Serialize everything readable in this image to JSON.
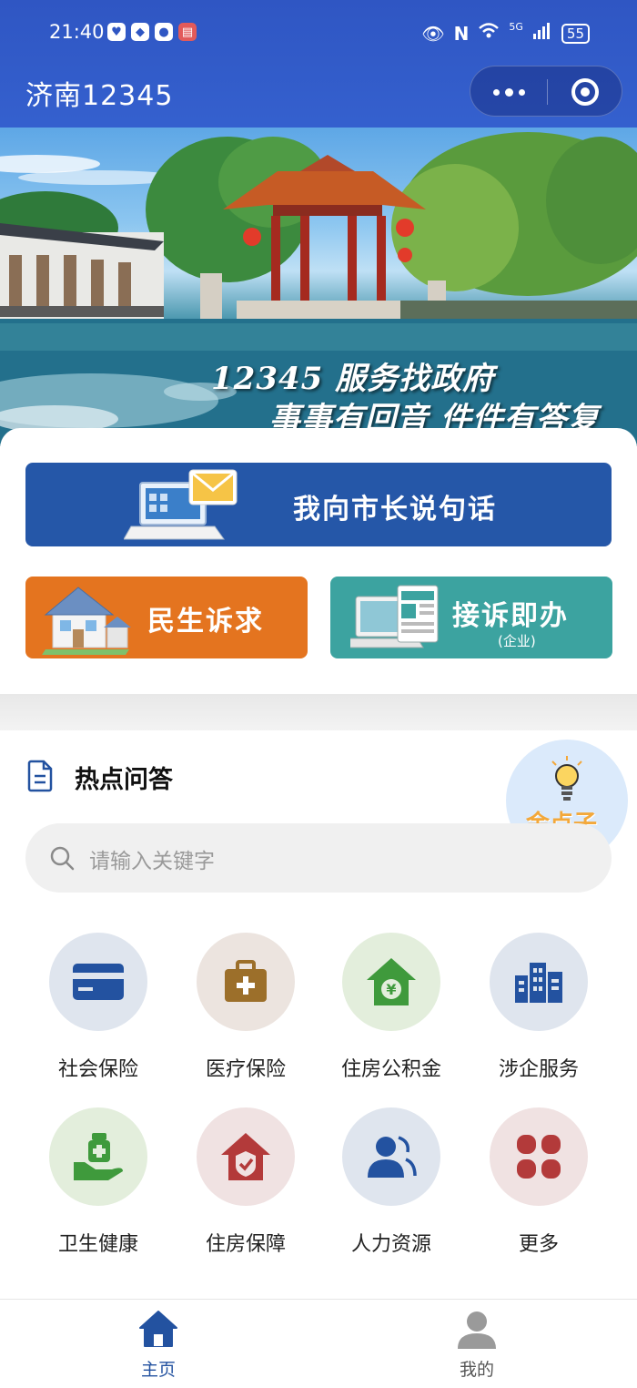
{
  "status_bar": {
    "time": "21:40",
    "network": "5G",
    "battery": "55"
  },
  "header": {
    "title": "济南12345"
  },
  "banner": {
    "slogan_line1": "12345 服务找政府",
    "slogan_line2": "事事有回音 件件有答复"
  },
  "actions": {
    "mayor_label": "我向市长说句话",
    "complaint_label": "民生诉求",
    "enterprise_label": "接诉即办",
    "enterprise_sub": "(企业)"
  },
  "qa": {
    "title": "热点问答",
    "badge": "金点子",
    "search_placeholder": "请输入关键字"
  },
  "services": [
    {
      "label": "社会保险",
      "icon": "card-icon",
      "bg": "#dfe5ee",
      "color": "#2352a0"
    },
    {
      "label": "医疗保险",
      "icon": "medkit-icon",
      "bg": "#ece4df",
      "color": "#9c6f2a"
    },
    {
      "label": "住房公积金",
      "icon": "house-yuan-icon",
      "bg": "#e3eedc",
      "color": "#3f9a3c"
    },
    {
      "label": "涉企服务",
      "icon": "buildings-icon",
      "bg": "#dfe5ee",
      "color": "#2352a0"
    },
    {
      "label": "卫生健康",
      "icon": "health-hand-icon",
      "bg": "#e3eedc",
      "color": "#3f9a3c"
    },
    {
      "label": "住房保障",
      "icon": "house-shield-icon",
      "bg": "#f0e2e2",
      "color": "#b33a3a"
    },
    {
      "label": "人力资源",
      "icon": "person-icon",
      "bg": "#dfe5ee",
      "color": "#2352a0"
    },
    {
      "label": "更多",
      "icon": "more-grid-icon",
      "bg": "#f0e2e2",
      "color": "#b33a3a"
    }
  ],
  "tabbar": {
    "home": "主页",
    "mine": "我的",
    "active_color": "#2352a0",
    "inactive_color": "#555555"
  }
}
